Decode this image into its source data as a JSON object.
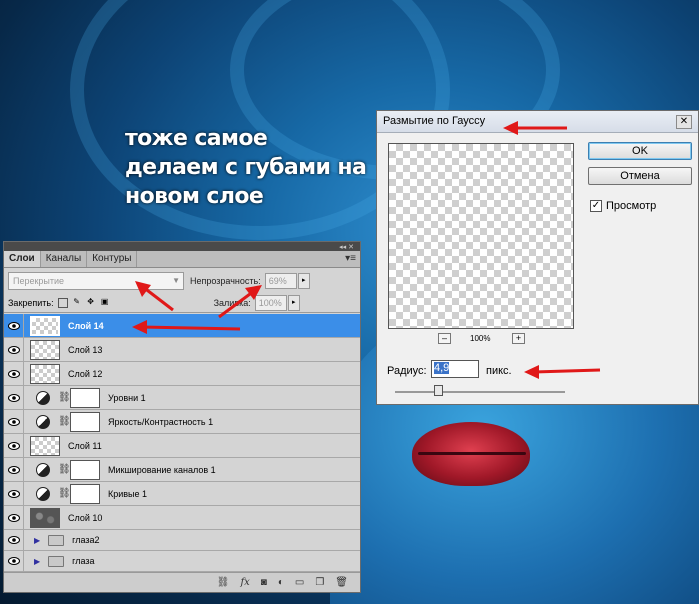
{
  "caption": {
    "line1": "тоже самое",
    "line2": "делаем с губами на",
    "line3": "новом слое"
  },
  "layers_panel": {
    "tabs": [
      "Слои",
      "Каналы",
      "Контуры"
    ],
    "blend_mode": "Перекрытие",
    "opacity_label": "Непрозрачность:",
    "opacity_value": "69%",
    "lock_label": "Закрепить:",
    "fill_label": "Заливка:",
    "fill_value": "100%",
    "layers": [
      {
        "name": "Слой 14",
        "selected": true,
        "type": "pixel"
      },
      {
        "name": "Слой 13",
        "type": "pixel"
      },
      {
        "name": "Слой 12",
        "type": "pixel"
      },
      {
        "name": "Уровни 1",
        "type": "adjustment"
      },
      {
        "name": "Яркость/Контрастность 1",
        "type": "adjustment"
      },
      {
        "name": "Слой 11",
        "type": "pixel"
      },
      {
        "name": "Микширование каналов 1",
        "type": "adjustment"
      },
      {
        "name": "Кривые 1",
        "type": "adjustment"
      },
      {
        "name": "Слой 10",
        "type": "photo"
      },
      {
        "name": "глаза2",
        "type": "group"
      },
      {
        "name": "глаза",
        "type": "group"
      }
    ]
  },
  "gauss_dialog": {
    "title": "Размытие по Гауссу",
    "ok_label": "OK",
    "cancel_label": "Отмена",
    "preview_label": "Просмотр",
    "preview_checked": true,
    "zoom": "100%",
    "zoom_out": "–",
    "zoom_in": "+",
    "radius_label": "Радиус:",
    "radius_value": "4,9",
    "radius_unit": "пикс."
  },
  "colors": {
    "annotation_arrow": "#e01818",
    "selection": "#3b8ee8"
  }
}
